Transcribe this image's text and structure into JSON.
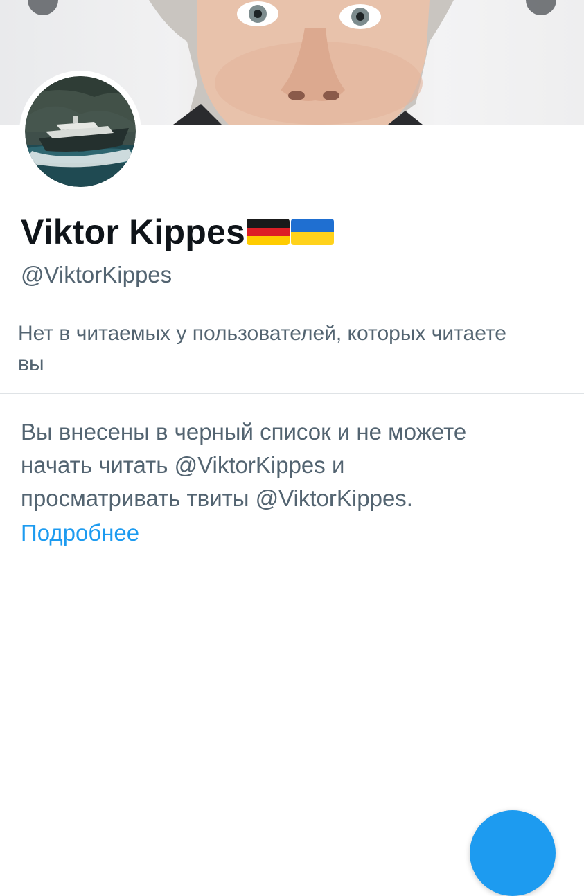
{
  "profile": {
    "display_name": "Viktor Kippes",
    "flags": [
      "germany-flag",
      "ukraine-flag"
    ],
    "handle": "@ViktorKippes",
    "followers_note": "Нет в читаемых у пользователей, которых читаете вы"
  },
  "blocked_notice": {
    "message": "Вы внесены в черный список и не можете начать читать @ViktorKippes и просматривать твиты @ViktorKippes.",
    "learn_more": "Подробнее"
  },
  "colors": {
    "accent": "#1d9bf0",
    "secondary_text": "#536471",
    "primary_text": "#0f1419"
  },
  "icons": {
    "back": "back-button",
    "more": "more-button",
    "compose": "compose-fab"
  }
}
